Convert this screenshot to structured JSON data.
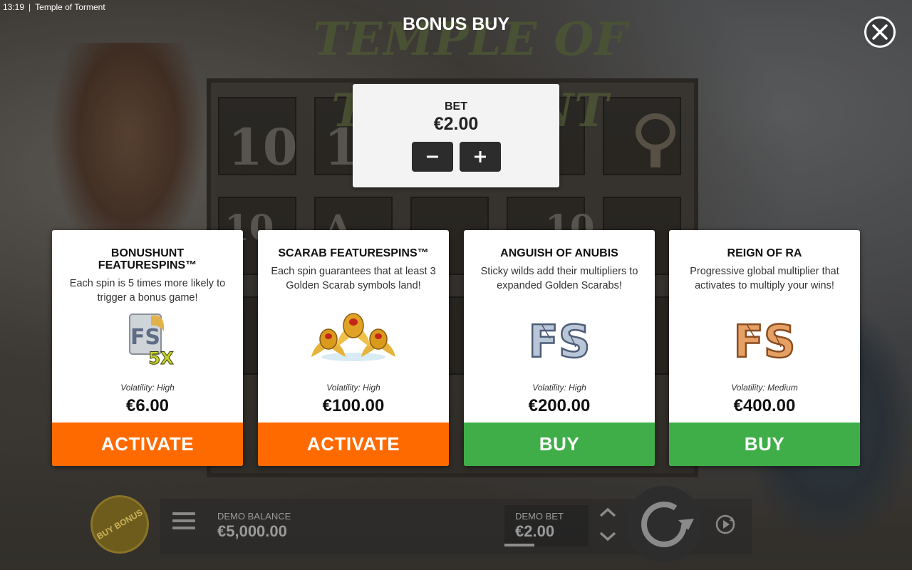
{
  "status_bar": {
    "time": "13:19",
    "separator": "|",
    "app_name": "Temple of Torment"
  },
  "background": {
    "game_logo": "TEMPLE OF TORMENT",
    "reel_symbols": [
      "10",
      "1",
      "10",
      "A",
      "10"
    ]
  },
  "modal": {
    "title": "BONUS BUY",
    "close_icon": "close-icon"
  },
  "bet_panel": {
    "label": "BET",
    "value": "€2.00",
    "decrease_icon": "minus-icon",
    "increase_icon": "plus-icon"
  },
  "offers": [
    {
      "title": "BONUSHUNT FEATURESPINS™",
      "description": "Each spin is 5 times more likely to trigger a bonus game!",
      "art": "bonushunt-featurespins-5x-art",
      "badge_text": "5X",
      "volatility": "Volatility: High",
      "price": "€6.00",
      "action": "ACTIVATE",
      "action_color": "#ff6a00"
    },
    {
      "title": "SCARAB FEATURESPINS™",
      "description": "Each spin guarantees that at least 3 Golden Scarab symbols land!",
      "art": "golden-scarabs-art",
      "volatility": "Volatility: High",
      "price": "€100.00",
      "action": "ACTIVATE",
      "action_color": "#ff6a00"
    },
    {
      "title": "ANGUISH OF ANUBIS",
      "description": "Sticky wilds add their multipliers to expanded Golden Scarabs!",
      "art": "fs-stone-blue-art",
      "badge_text": "FS",
      "volatility": "Volatility: High",
      "price": "€200.00",
      "action": "BUY",
      "action_color": "#3fae49"
    },
    {
      "title": "REIGN OF RA",
      "description": "Progressive global multiplier that activates to multiply your wins!",
      "art": "fs-stone-orange-art",
      "badge_text": "FS",
      "volatility": "Volatility: Medium",
      "price": "€400.00",
      "action": "BUY",
      "action_color": "#3fae49"
    }
  ],
  "bottom_bar": {
    "buy_bonus": "BUY BONUS",
    "balance_label": "DEMO BALANCE",
    "balance_value": "€5,000.00",
    "bet_label": "DEMO BET",
    "bet_value": "€2.00",
    "bet_progress": 0.36,
    "menu_icon": "hamburger-menu-icon",
    "spin_icon": "spin-arrow-icon",
    "autoplay_icon": "autoplay-icon"
  }
}
